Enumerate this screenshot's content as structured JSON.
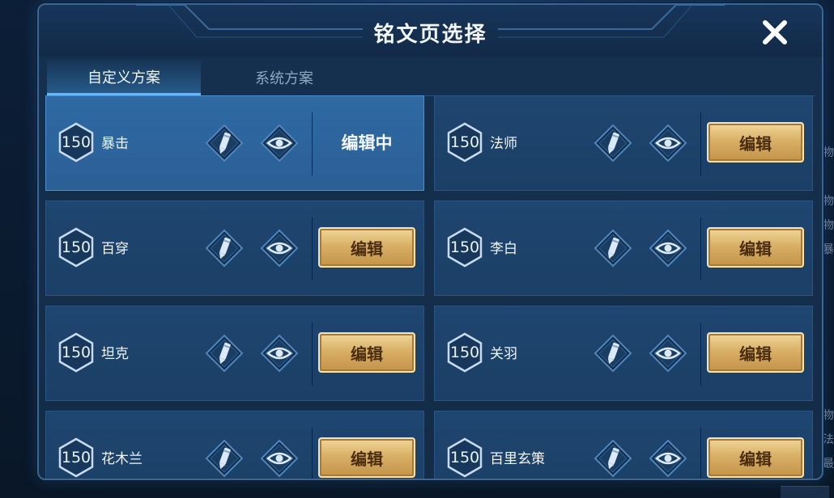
{
  "dialog": {
    "title": "铭文页选择",
    "close_icon": "close-icon"
  },
  "tabs": [
    {
      "label": "自定义方案",
      "active": true
    },
    {
      "label": "系统方案",
      "active": false
    }
  ],
  "pages": [
    {
      "level": "150",
      "name": "暴击",
      "action": "编辑中",
      "selected": true
    },
    {
      "level": "150",
      "name": "法师",
      "action": "编辑",
      "selected": false
    },
    {
      "level": "150",
      "name": "百穿",
      "action": "编辑",
      "selected": false
    },
    {
      "level": "150",
      "name": "李白",
      "action": "编辑",
      "selected": false
    },
    {
      "level": "150",
      "name": "坦克",
      "action": "编辑",
      "selected": false
    },
    {
      "level": "150",
      "name": "关羽",
      "action": "编辑",
      "selected": false
    },
    {
      "level": "150",
      "name": "花木兰",
      "action": "编辑",
      "selected": false
    },
    {
      "level": "150",
      "name": "百里玄策",
      "action": "编辑",
      "selected": false
    }
  ],
  "background_hints": [
    "物",
    "物",
    "物",
    "暴",
    "物",
    "法",
    "最"
  ],
  "colors": {
    "accent_blue": "#5fb7ff",
    "gold_button": "#d9b066",
    "card_bg": "#1f4670",
    "card_selected": "#2f6aa3"
  }
}
